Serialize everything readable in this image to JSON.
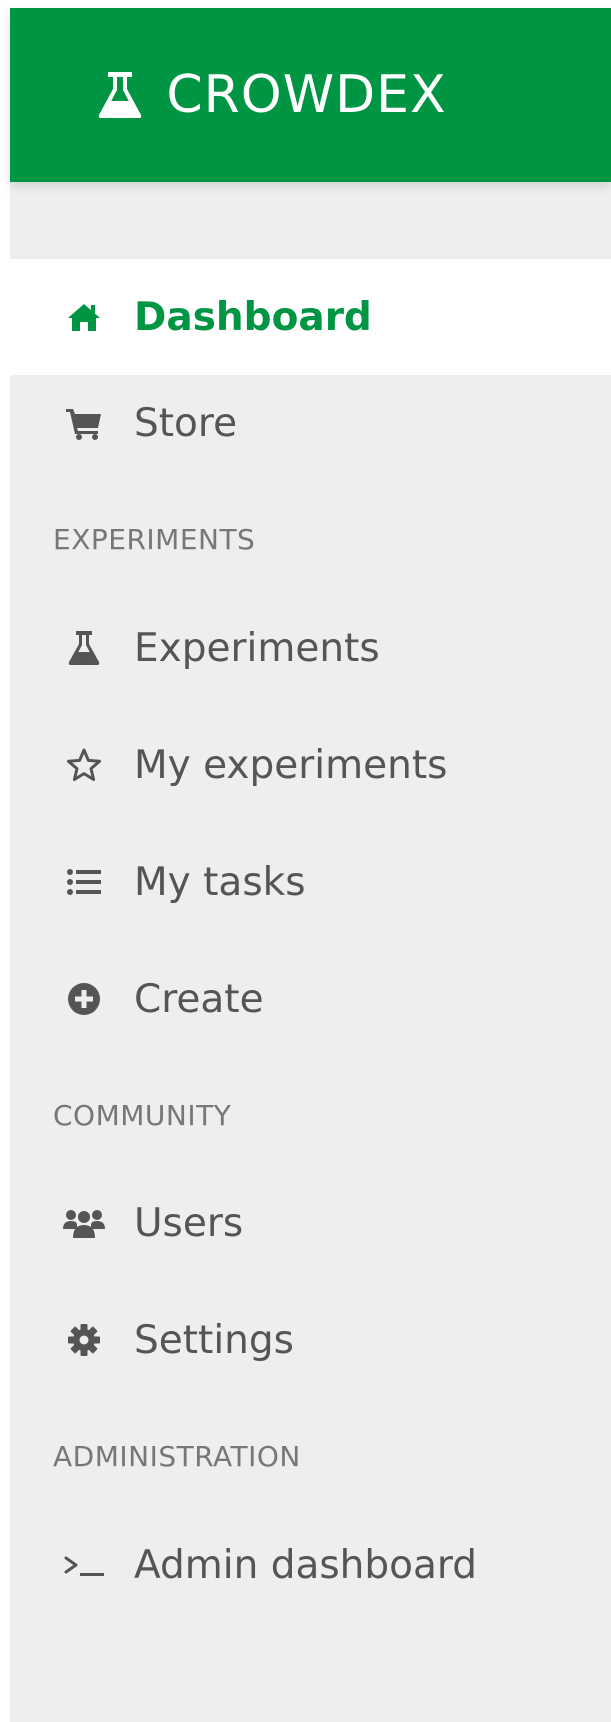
{
  "brand": {
    "name": "CROWDEX",
    "icon": "flask-icon",
    "color": "#009543"
  },
  "menu": [
    {
      "label": "Dashboard",
      "icon": "home-icon",
      "active": true
    },
    {
      "label": "Store",
      "icon": "cart-icon",
      "active": false
    }
  ],
  "sections": [
    {
      "title": "EXPERIMENTS",
      "items": [
        {
          "label": "Experiments",
          "icon": "flask-icon"
        },
        {
          "label": "My experiments",
          "icon": "star-icon"
        },
        {
          "label": "My tasks",
          "icon": "list-icon"
        },
        {
          "label": "Create",
          "icon": "plus-circle-icon"
        }
      ]
    },
    {
      "title": "COMMUNITY",
      "items": [
        {
          "label": "Users",
          "icon": "users-icon"
        },
        {
          "label": "Settings",
          "icon": "gear-icon"
        }
      ]
    },
    {
      "title": "ADMINISTRATION",
      "items": [
        {
          "label": "Admin dashboard",
          "icon": "terminal-icon"
        }
      ]
    }
  ],
  "colors": {
    "accent": "#009543",
    "sidebar_bg": "#eeeeee",
    "text": "#555555"
  }
}
